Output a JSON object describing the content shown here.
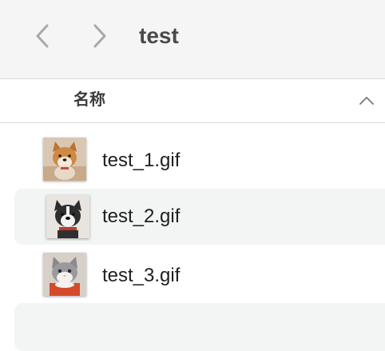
{
  "toolbar": {
    "title": "test",
    "back_icon": "chevron-left-icon",
    "forward_icon": "chevron-right-icon"
  },
  "list_header": {
    "name_column": "名称",
    "sort_icon": "chevron-up-icon"
  },
  "files": [
    {
      "name": "test_1.gif",
      "thumbnail": "shiba-dog-photo"
    },
    {
      "name": "test_2.gif",
      "thumbnail": "black-white-dog-photo"
    },
    {
      "name": "test_3.gif",
      "thumbnail": "gray-cat-photo"
    }
  ],
  "colors": {
    "toolbar_bg": "#f5f5f5",
    "alt_row_bg": "#f3f4f4",
    "text": "#1f1f1f"
  }
}
